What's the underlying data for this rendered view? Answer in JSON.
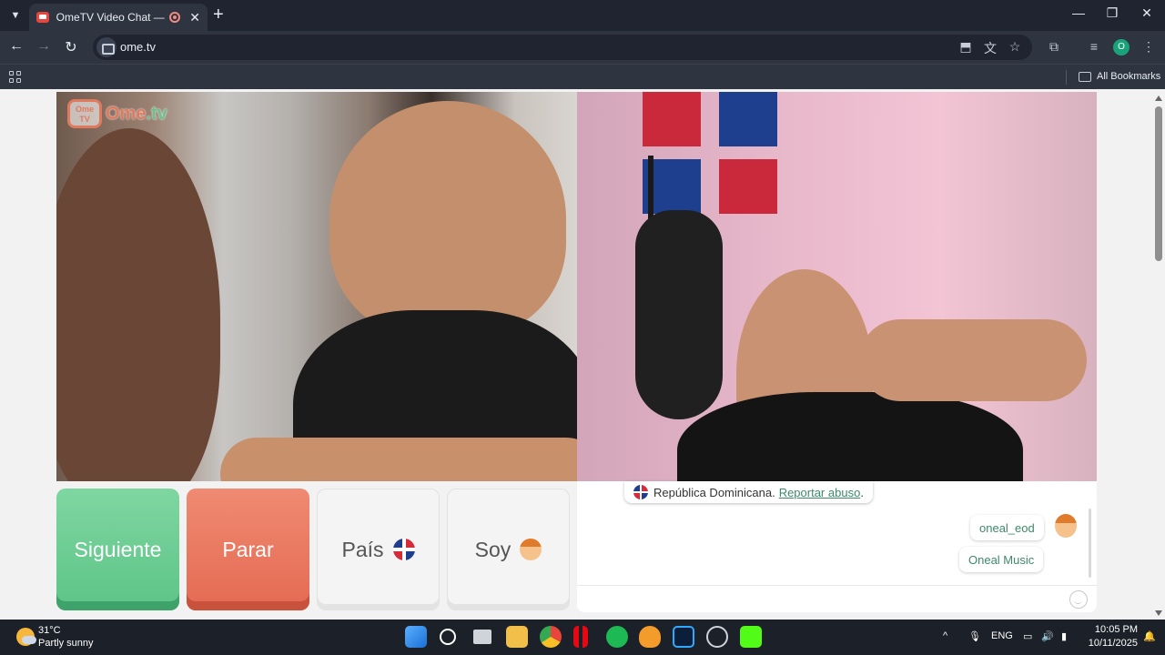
{
  "browser": {
    "tab_title": "OmeTV Video Chat — Ome",
    "tab_close": "✕",
    "new_tab": "+",
    "url": "ome.tv",
    "bookmarks_label": "All Bookmarks",
    "profile_initial": "O",
    "window_controls": {
      "minimize": "—",
      "maximize": "❐",
      "close": "✕"
    }
  },
  "logo": {
    "box_text": "Ome TV",
    "brand": "Ome",
    "brand_suffix": ".tv"
  },
  "controls": {
    "next_label": "Siguiente",
    "stop_label": "Parar",
    "country_label": "País",
    "gender_label": "Soy"
  },
  "chat": {
    "system_country": "República Dominicana.",
    "report_link": "Reportar abuso",
    "report_suffix": ".",
    "messages": [
      {
        "text": "oneal_eod"
      },
      {
        "text": "Oneal Music"
      }
    ]
  },
  "taskbar": {
    "weather_temp": "31°C",
    "weather_desc": "Partly sunny",
    "language": "ENG",
    "time": "10:05 PM",
    "date": "10/11/2025",
    "apps": [
      "windows-start-icon",
      "search-icon",
      "task-view-icon",
      "file-explorer-icon",
      "chrome-icon",
      "netflix-icon",
      "spotify-icon",
      "fl-studio-icon",
      "photoshop-icon",
      "kick-icon"
    ]
  },
  "colors": {
    "next_button": "#5cc487",
    "stop_button": "#e46a52",
    "link": "#3d8a6a",
    "browser_dark": "#2e3440"
  }
}
